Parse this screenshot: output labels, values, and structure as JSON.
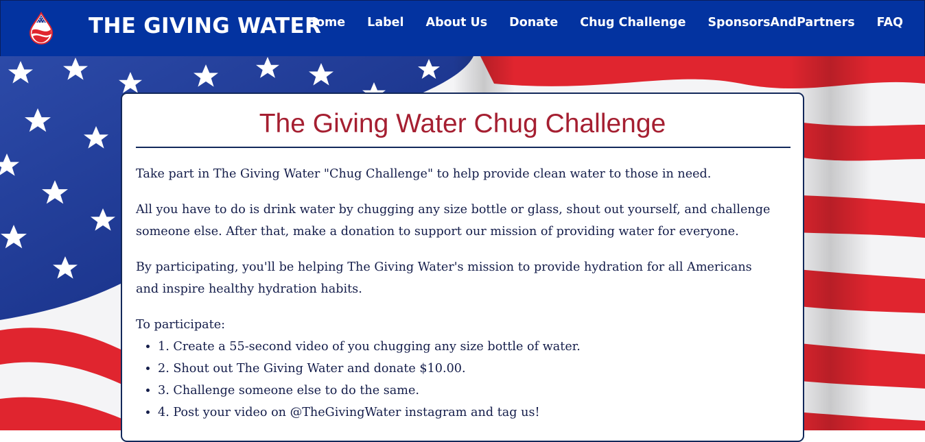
{
  "header": {
    "brand": "THE GIVING WATER",
    "logo_icon": "water-drop-flag-logo-icon",
    "nav": [
      {
        "label": "Home"
      },
      {
        "label": "Label"
      },
      {
        "label": "About Us"
      },
      {
        "label": "Donate"
      },
      {
        "label": "Chug Challenge"
      },
      {
        "label": "SponsorsAndPartners"
      },
      {
        "label": "FAQ"
      }
    ]
  },
  "colors": {
    "header_bg": "#0333a0",
    "title_red": "#a51f31",
    "text_navy": "#141d4a",
    "flag_red": "#e0252f",
    "flag_blue": "#1f3a93"
  },
  "card": {
    "title": "The Giving Water Chug Challenge",
    "paragraphs": [
      "Take part in The Giving Water \"Chug Challenge\" to help provide clean water to those in need.",
      "All you have to do is drink water by chugging any size bottle or glass, shout out yourself, and challenge someone else. After that, make a donation to support our mission of providing water for everyone.",
      "By participating, you'll be helping The Giving Water's mission to provide hydration for all Americans and inspire healthy hydration habits."
    ],
    "steps_label": "To participate:",
    "steps": [
      "1. Create a 55-second video of you chugging any size bottle of water.",
      "2. Shout out The Giving Water and donate $10.00.",
      "3. Challenge someone else to do the same.",
      "4. Post your video on @TheGivingWater instagram and tag us!"
    ]
  }
}
